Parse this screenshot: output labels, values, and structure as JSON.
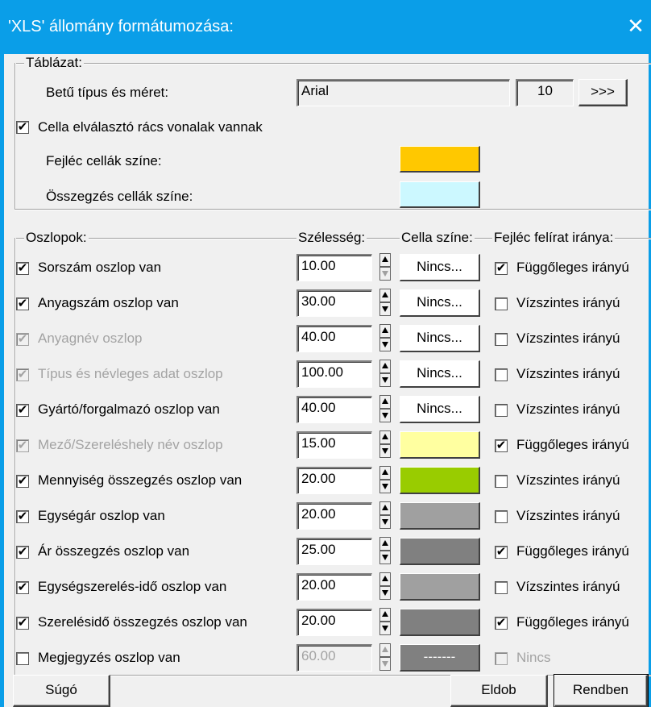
{
  "window": {
    "title": "'XLS' állomány formátumozása:",
    "close_glyph": "✕"
  },
  "table_group": {
    "label": "Táblázat:",
    "font_label": "Betű típus és méret:",
    "font_name": "Arial",
    "font_size": "10",
    "font_button": ">>>",
    "grid_check_label": "Cella elválasztó rács vonalak vannak",
    "grid_checked": true,
    "header_color_label": "Fejléc cellák színe:",
    "header_color": "#ffc800",
    "summary_color_label": "Összegzés cellák színe:",
    "summary_color": "#ccf8ff"
  },
  "columns_group": {
    "label": "Oszlopok:",
    "width_header": "Szélesség:",
    "color_header": "Cella színe:",
    "direction_header": "Fejléc felírat iránya:",
    "rows": [
      {
        "name": "Sorszám oszlop van",
        "checked": true,
        "enabled": true,
        "width": "10.00",
        "color_text": "Nincs...",
        "color": "#ffffff",
        "dir_checked": true,
        "dir_label": "Függőleges irányú"
      },
      {
        "name": "Anyagszám oszlop van",
        "checked": true,
        "enabled": true,
        "width": "30.00",
        "color_text": "Nincs...",
        "color": "#ffffff",
        "dir_checked": false,
        "dir_label": "Vízszintes irányú"
      },
      {
        "name": "Anyagnév oszlop",
        "checked": true,
        "enabled": false,
        "width": "40.00",
        "color_text": "Nincs...",
        "color": "#ffffff",
        "dir_checked": false,
        "dir_label": "Vízszintes irányú"
      },
      {
        "name": "Típus és névleges adat oszlop",
        "checked": true,
        "enabled": false,
        "width": "100.00",
        "color_text": "Nincs...",
        "color": "#ffffff",
        "dir_checked": false,
        "dir_label": "Vízszintes irányú"
      },
      {
        "name": "Gyártó/forgalmazó oszlop van",
        "checked": true,
        "enabled": true,
        "width": "40.00",
        "color_text": "Nincs...",
        "color": "#ffffff",
        "dir_checked": false,
        "dir_label": "Vízszintes irányú"
      },
      {
        "name": "Mező/Szereléshely név oszlop",
        "checked": true,
        "enabled": false,
        "width": "15.00",
        "color_text": "",
        "color": "#ffffa0",
        "dir_checked": true,
        "dir_label": "Függőleges irányú"
      },
      {
        "name": "Mennyiség összegzés oszlop van",
        "checked": true,
        "enabled": true,
        "width": "20.00",
        "color_text": "",
        "color": "#99cc00",
        "dir_checked": false,
        "dir_label": "Vízszintes irányú"
      },
      {
        "name": "Egységár oszlop van",
        "checked": true,
        "enabled": true,
        "width": "20.00",
        "color_text": "",
        "color": "#a0a0a0",
        "dir_checked": false,
        "dir_label": "Vízszintes irányú"
      },
      {
        "name": "Ár összegzés oszlop van",
        "checked": true,
        "enabled": true,
        "width": "25.00",
        "color_text": "",
        "color": "#808080",
        "dir_checked": true,
        "dir_label": "Függőleges irányú"
      },
      {
        "name": "Egységszerelés-idő oszlop van",
        "checked": true,
        "enabled": true,
        "width": "20.00",
        "color_text": "",
        "color": "#a0a0a0",
        "dir_checked": false,
        "dir_label": "Vízszintes irányú"
      },
      {
        "name": "Szerelésidő összegzés oszlop van",
        "checked": true,
        "enabled": true,
        "width": "20.00",
        "color_text": "",
        "color": "#808080",
        "dir_checked": true,
        "dir_label": "Függőleges irányú"
      },
      {
        "name": "Megjegyzés oszlop van",
        "checked": false,
        "enabled": true,
        "width": "60.00",
        "width_disabled": true,
        "color_text": "-------",
        "color": "#808080",
        "dir_checked": false,
        "dir_label": "Nincs",
        "dir_disabled": true
      }
    ]
  },
  "buttons": {
    "help": "Súgó",
    "discard": "Eldob",
    "ok": "Rendben"
  },
  "check_glyph": "✔"
}
